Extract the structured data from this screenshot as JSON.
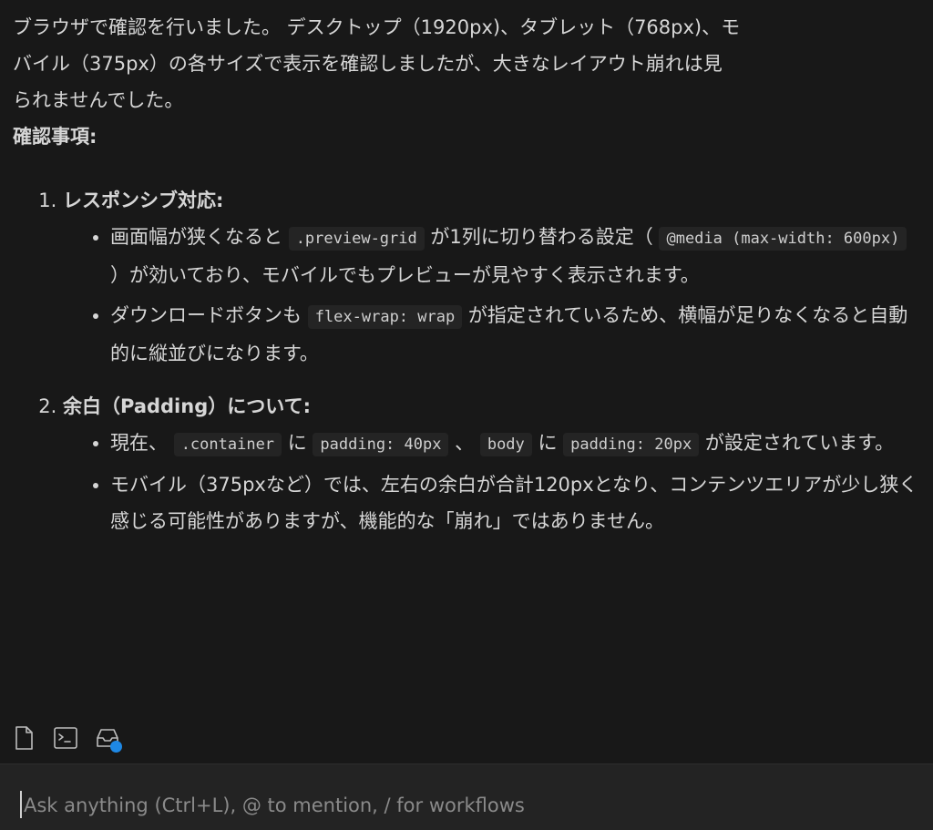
{
  "message": {
    "intro_lines": [
      "ブラウザで確認を行いました。 デスクトップ（1920px)、タブレット（768px)、モ",
      "バイル（375px）の各サイズで表示を確認しましたが、大きなレイアウト崩れは見",
      "られませんでした。"
    ],
    "heading": "確認事項:",
    "items": [
      {
        "number": "1.",
        "title": "レスポンシブ対応:",
        "bullets": [
          {
            "t1": "画面幅が狭くなると ",
            "c1": ".preview-grid",
            "t2": " が1列に切り替わる設定（ ",
            "c2": "@media (max-width: 600px)",
            "t3": " ）が効いており、モバイルでもプレビューが見やすく表示されます。"
          },
          {
            "t1": "ダウンロードボタンも ",
            "c1": "flex-wrap: wrap",
            "t2": " が指定されているため、横幅が足りなくなると自動的に縦並びになります。"
          }
        ]
      },
      {
        "number": "2.",
        "title": "余白（Padding）について:",
        "bullets": [
          {
            "t1": "現在、 ",
            "c1": ".container",
            "t2": " に ",
            "c2": "padding: 40px",
            "t3": " 、 ",
            "c3": "body",
            "t4": " に ",
            "c4": "padding: 20px",
            "t5": " が設定されています。"
          },
          {
            "t1": "モバイル（375pxなど）では、左右の余白が合計120pxとなり、コンテンツエリアが少し狭く感じる可能性がありますが、機能的な「崩れ」ではありません。"
          }
        ]
      }
    ]
  },
  "toolbar": {
    "icons": [
      "file-icon",
      "terminal-icon",
      "inbox-icon"
    ],
    "status_dot_color": "#1e88e5"
  },
  "input": {
    "placeholder": "Ask anything (Ctrl+L), @ to mention, / for workflows"
  },
  "colors": {
    "background": "#181818",
    "input_bar": "#232323",
    "text": "#d6d6d6",
    "code_bg": "#242424"
  }
}
